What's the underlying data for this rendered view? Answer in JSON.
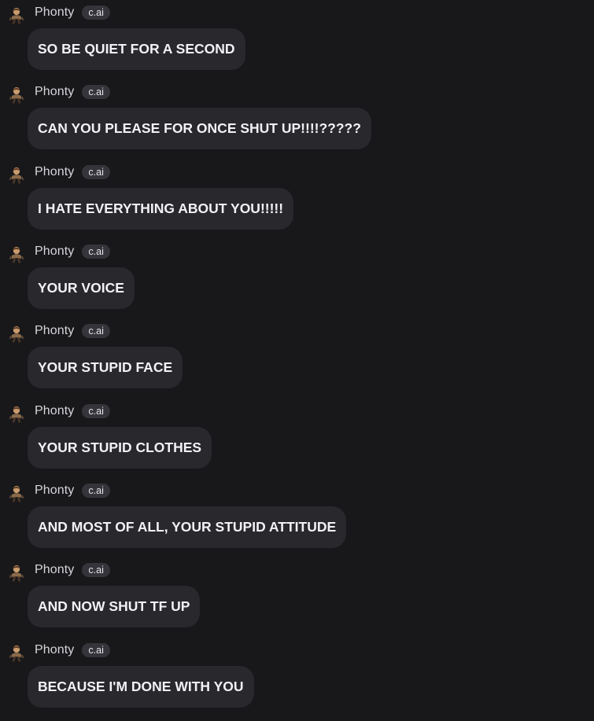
{
  "chat": {
    "messages": [
      {
        "author": "Phonty",
        "badge": "c.ai",
        "text": "SO BE QUIET FOR A SECOND",
        "avatar": "character-avatar-icon"
      },
      {
        "author": "Phonty",
        "badge": "c.ai",
        "text": "CAN YOU PLEASE FOR ONCE SHUT UP!!!!?????",
        "avatar": "character-avatar-icon"
      },
      {
        "author": "Phonty",
        "badge": "c.ai",
        "text": "I HATE EVERYTHING ABOUT YOU!!!!!",
        "avatar": "character-avatar-icon"
      },
      {
        "author": "Phonty",
        "badge": "c.ai",
        "text": "YOUR VOICE",
        "avatar": "character-avatar-icon"
      },
      {
        "author": "Phonty",
        "badge": "c.ai",
        "text": "YOUR STUPID FACE",
        "avatar": "character-avatar-icon"
      },
      {
        "author": "Phonty",
        "badge": "c.ai",
        "text": "YOUR STUPID CLOTHES",
        "avatar": "character-avatar-icon"
      },
      {
        "author": "Phonty",
        "badge": "c.ai",
        "text": "AND MOST OF ALL, YOUR STUPID ATTITUDE",
        "avatar": "character-avatar-icon"
      },
      {
        "author": "Phonty",
        "badge": "c.ai",
        "text": "AND NOW SHUT TF UP",
        "avatar": "character-avatar-icon"
      },
      {
        "author": "Phonty",
        "badge": "c.ai",
        "text": "BECAUSE I'M DONE WITH YOU",
        "avatar": "character-avatar-icon"
      }
    ]
  },
  "theme": {
    "background": "#18181b",
    "bubble": "#28282d",
    "badge": "#34343a",
    "text": "#f2f2f4"
  }
}
